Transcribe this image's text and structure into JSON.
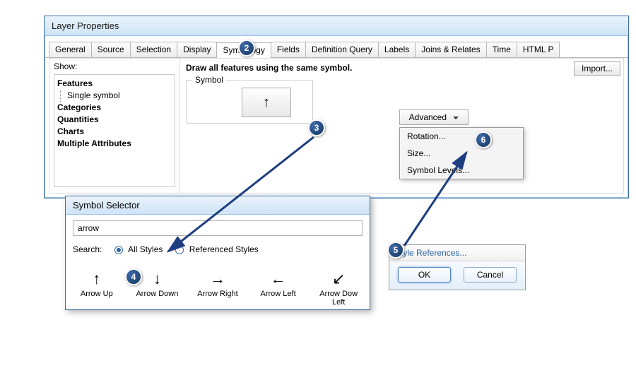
{
  "layerProps": {
    "title": "Layer Properties",
    "tabs": [
      "General",
      "Source",
      "Selection",
      "Display",
      "Symbology",
      "Fields",
      "Definition Query",
      "Labels",
      "Joins & Relates",
      "Time",
      "HTML P"
    ],
    "activeTab": "Symbology",
    "show_label": "Show:",
    "tree": {
      "features": "Features",
      "single": "Single symbol",
      "categories": "Categories",
      "quantities": "Quantities",
      "charts": "Charts",
      "multiple": "Multiple Attributes"
    },
    "heading": "Draw all features using the same symbol.",
    "symbol_label": "Symbol",
    "import_label": "Import...",
    "advanced_label": "Advanced",
    "adv_menu": [
      "Rotation...",
      "Size...",
      "Symbol Levels..."
    ]
  },
  "symbolSelector": {
    "title": "Symbol Selector",
    "search_value": "arrow",
    "search_label": "Search:",
    "all_styles": "All Styles",
    "referenced_styles": "Referenced Styles",
    "items": [
      {
        "glyph": "↑",
        "label": "Arrow Up"
      },
      {
        "glyph": "↓",
        "label": "Arrow Down"
      },
      {
        "glyph": "→",
        "label": "Arrow Right"
      },
      {
        "glyph": "←",
        "label": "Arrow Left"
      },
      {
        "glyph": "↙",
        "label": "Arrow Dow Left"
      }
    ]
  },
  "styleRef": {
    "link": "Style References...",
    "ok": "OK",
    "cancel": "Cancel"
  },
  "callouts": {
    "2": "2",
    "3": "3",
    "4": "4",
    "5": "5",
    "6": "6"
  }
}
